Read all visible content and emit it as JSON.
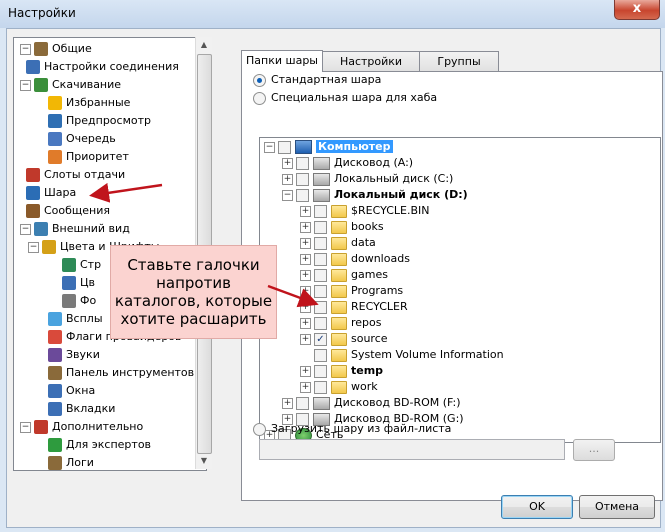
{
  "window": {
    "title": "Настройки",
    "close": "x"
  },
  "left_tree": [
    {
      "label": "Общие",
      "icon": "general-icon",
      "color": "#8a6a3a"
    },
    {
      "label": "Настройки соединения",
      "icon": "connection-icon",
      "color": "#3c6fb5"
    },
    {
      "label": "Скачивание",
      "icon": "download-icon",
      "color": "#3b8f3b"
    },
    {
      "label": "Избранные",
      "icon": "star-icon",
      "color": "#f2b705"
    },
    {
      "label": "Предпросмотр",
      "icon": "preview-icon",
      "color": "#2f6fb3"
    },
    {
      "label": "Очередь",
      "icon": "queue-icon",
      "color": "#4a78c0"
    },
    {
      "label": "Приоритет",
      "icon": "priority-icon",
      "color": "#e07b2a"
    },
    {
      "label": "Слоты отдачи",
      "icon": "upload-slots-icon",
      "color": "#c0392b"
    },
    {
      "label": "Шара",
      "icon": "share-icon",
      "color": "#2b6db5"
    },
    {
      "label": "Сообщения",
      "icon": "messages-icon",
      "color": "#8a5a2a"
    },
    {
      "label": "Внешний вид",
      "icon": "appearance-icon",
      "color": "#3c7fb1"
    },
    {
      "label": "Цвета и Шрифты",
      "icon": "palette-icon",
      "color": "#d4a017"
    },
    {
      "label": "Стр",
      "icon": "styles-icon",
      "color": "#2e8b57"
    },
    {
      "label": "Цв",
      "icon": "colors-icon",
      "color": "#3c6fb5"
    },
    {
      "label": "Фо",
      "icon": "fonts-icon",
      "color": "#7a7a7a"
    },
    {
      "label": "Всплы",
      "icon": "popups-icon",
      "color": "#4aa3df"
    },
    {
      "label": "Флаги провайдеров",
      "icon": "flags-icon",
      "color": "#d94a3b"
    },
    {
      "label": "Звуки",
      "icon": "sounds-icon",
      "color": "#6b4a9a"
    },
    {
      "label": "Панель инструментов",
      "icon": "toolbar-icon",
      "color": "#8a6a3a"
    },
    {
      "label": "Окна",
      "icon": "windows-icon",
      "color": "#3c6fb5"
    },
    {
      "label": "Вкладки",
      "icon": "tabs-icon",
      "color": "#3c6fb5"
    },
    {
      "label": "Дополнительно",
      "icon": "advanced-icon",
      "color": "#c0392b"
    },
    {
      "label": "Для экспертов",
      "icon": "experts-icon",
      "color": "#2e9b3e"
    },
    {
      "label": "Логи",
      "icon": "logs-icon",
      "color": "#8a6a3a"
    }
  ],
  "tabs": [
    "Папки шары",
    "Настройки Шары",
    "Группы шары"
  ],
  "radios": {
    "standard": "Стандартная шара",
    "hub": "Специальная шара для хаба",
    "filelist": "Загрузить шару из файл-листа"
  },
  "folder_tree": [
    {
      "label": "Компьютер",
      "type": "computer"
    },
    {
      "label": "Дисковод (A:)",
      "type": "drive"
    },
    {
      "label": "Локальный диск (C:)",
      "type": "drive"
    },
    {
      "label": "Локальный диск (D:)",
      "type": "drive"
    },
    {
      "label": "$RECYCLE.BIN",
      "type": "folder"
    },
    {
      "label": "books",
      "type": "folder"
    },
    {
      "label": "data",
      "type": "folder"
    },
    {
      "label": "downloads",
      "type": "folder"
    },
    {
      "label": "games",
      "type": "folder"
    },
    {
      "label": "Programs",
      "type": "folder"
    },
    {
      "label": "RECYCLER",
      "type": "folder"
    },
    {
      "label": "repos",
      "type": "folder"
    },
    {
      "label": "source",
      "type": "folder",
      "checked": true
    },
    {
      "label": "System Volume Information",
      "type": "folder"
    },
    {
      "label": "temp",
      "type": "folder"
    },
    {
      "label": "work",
      "type": "folder"
    },
    {
      "label": "Дисковод BD-ROM (F:)",
      "type": "drive"
    },
    {
      "label": "Дисковод BD-ROM (G:)",
      "type": "drive"
    },
    {
      "label": "Сеть",
      "type": "network"
    }
  ],
  "browse_label": "...",
  "buttons": {
    "ok": "OK",
    "cancel": "Отмена"
  },
  "callout": "Ставьте галочки напротив каталогов, которые хотите расшарить",
  "colors": {
    "selection": "#3399ff",
    "callout_bg": "#fbd3d0",
    "arrow": "#c0141c"
  }
}
